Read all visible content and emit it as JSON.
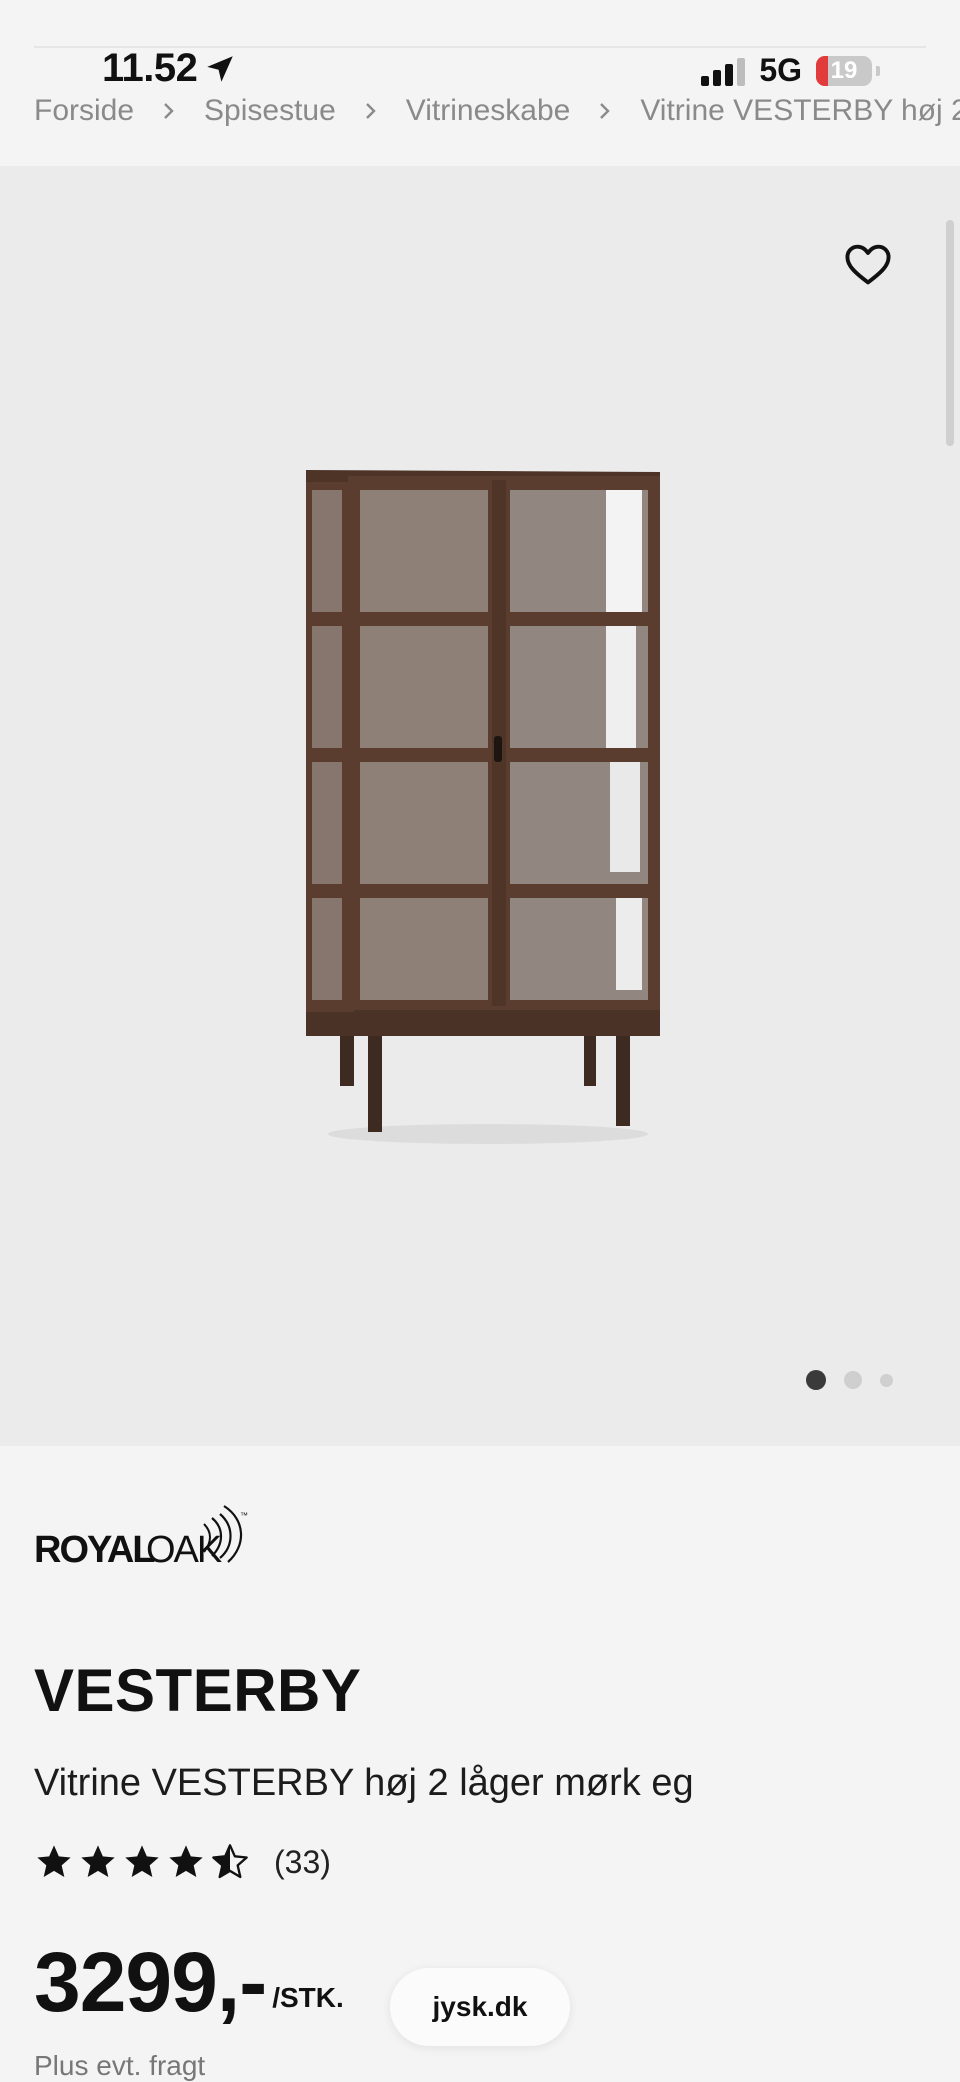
{
  "status": {
    "time": "11.52",
    "network": "5G",
    "battery": "19"
  },
  "breadcrumb": {
    "items": [
      "Forside",
      "Spisestue",
      "Vitrineskabe",
      "Vitrine VESTERBY høj 2"
    ]
  },
  "gallery": {
    "current_image": 1,
    "total_images": 3
  },
  "brand": {
    "logo_text": "ROYALOAK"
  },
  "product": {
    "name": "VESTERBY",
    "description": "Vitrine VESTERBY høj 2 låger mørk eg",
    "rating_value": 4.5,
    "rating_max": 5,
    "rating_count": "(33)",
    "price": "3299,-",
    "price_unit": "/STK.",
    "shipping_note": "Plus evt. fragt"
  },
  "browser": {
    "url": "jysk.dk"
  },
  "colors": {
    "page_bg": "#f4f4f4",
    "gallery_bg": "#ebebeb",
    "wood": "#5a3d2f",
    "battery_low": "#e23b3b"
  },
  "icons": {
    "favorite": "heart-icon",
    "location": "location-arrow-icon",
    "breadcrumb_separator": "chevron-right-icon"
  }
}
